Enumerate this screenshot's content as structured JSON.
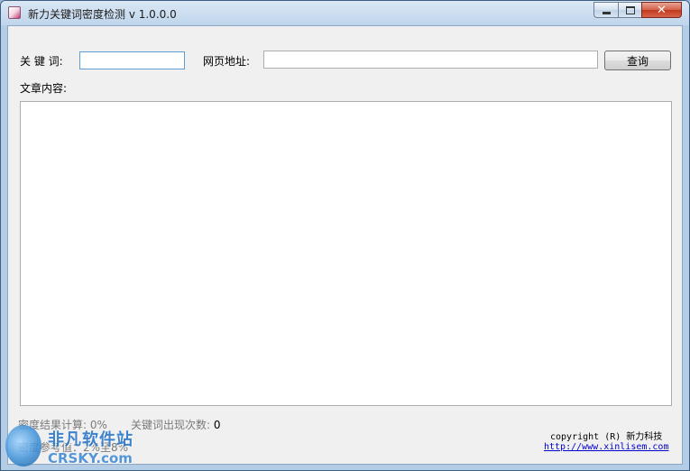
{
  "window": {
    "title": "新力关键词密度检测 v 1.0.0.0",
    "icon": "app-icon",
    "controls": {
      "minimize": "minimize-icon",
      "maximize": "maximize-icon",
      "close": "close-icon"
    }
  },
  "form": {
    "keyword_label": "关 键 词:",
    "keyword_value": "",
    "url_label": "网页地址:",
    "url_value": "",
    "query_button": "查询",
    "content_label": "文章内容:",
    "content_value": ""
  },
  "status": {
    "density_label": "密度结果计算:",
    "density_value": "0%",
    "count_label": "关键词出现次数:",
    "count_value": "0",
    "reference_text": "密度参考值：2%至8%"
  },
  "footer": {
    "copyright": "copyright (R) 新力科技",
    "website": "http://www.xinlisem.com"
  },
  "watermark": {
    "cn": "非凡软件站",
    "en": "CRSKY.com"
  }
}
